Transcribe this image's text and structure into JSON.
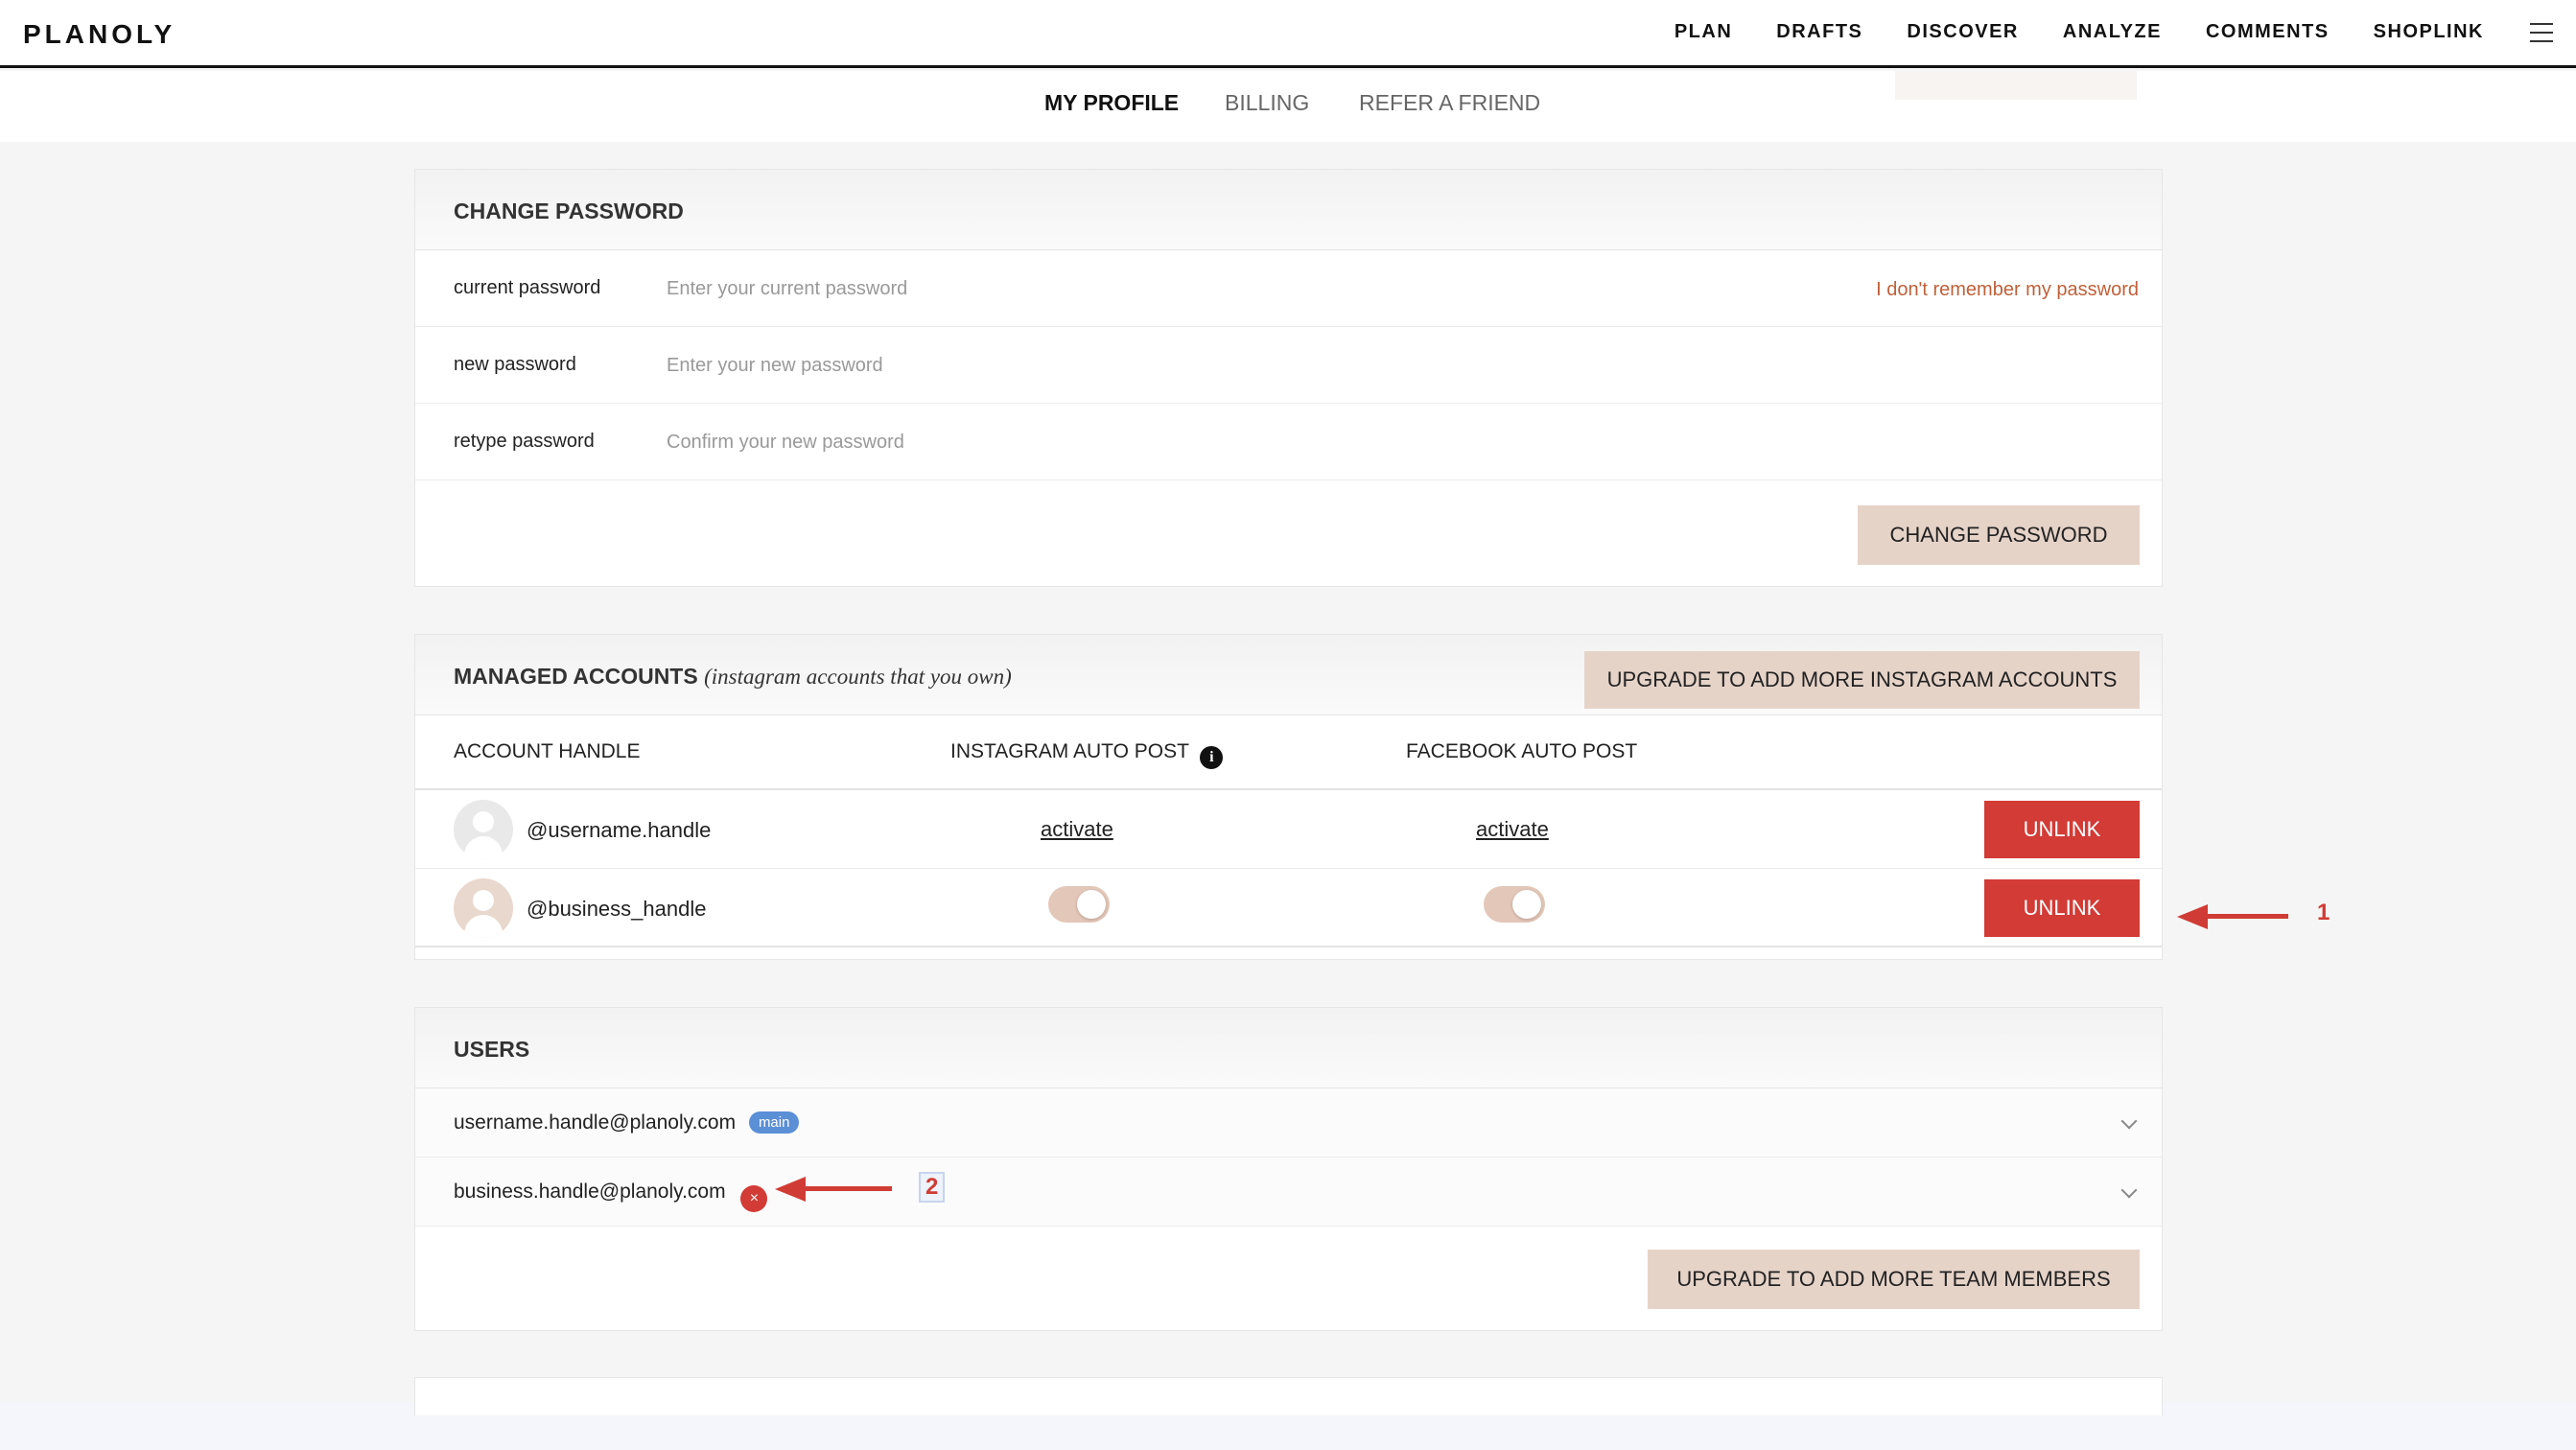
{
  "app": {
    "logo": "PLANOLY"
  },
  "nav": {
    "items": [
      "PLAN",
      "DRAFTS",
      "DISCOVER",
      "ANALYZE",
      "COMMENTS",
      "SHOPLINK"
    ]
  },
  "subtabs": {
    "items": [
      "MY PROFILE",
      "BILLING",
      "REFER A FRIEND"
    ],
    "active": "MY PROFILE"
  },
  "change_password": {
    "title": "CHANGE PASSWORD",
    "fields": [
      {
        "label": "current password",
        "placeholder": "Enter your current password"
      },
      {
        "label": "new password",
        "placeholder": "Enter your new password"
      },
      {
        "label": "retype password",
        "placeholder": "Confirm your new password"
      }
    ],
    "forgot_link": "I don't remember my password",
    "submit_label": "CHANGE PASSWORD"
  },
  "managed_accounts": {
    "title": "MANAGED ACCOUNTS",
    "subtitle": "(instagram accounts that you own)",
    "upgrade_label": "UPGRADE TO ADD MORE INSTAGRAM ACCOUNTS",
    "columns": [
      "ACCOUNT HANDLE",
      "INSTAGRAM AUTO POST",
      "FACEBOOK AUTO POST"
    ],
    "info_icon": "i",
    "rows": [
      {
        "handle": "@username.handle",
        "instagram": "activate",
        "facebook": "activate",
        "action": "UNLINK"
      },
      {
        "handle": "@business_handle",
        "instagram": "on",
        "facebook": "on",
        "action": "UNLINK"
      }
    ]
  },
  "users": {
    "title": "USERS",
    "rows": [
      {
        "email": "username.handle@planoly.com",
        "badge": "main"
      },
      {
        "email": "business.handle@planoly.com",
        "remove_icon": "×"
      }
    ],
    "upgrade_label": "UPGRADE TO ADD MORE TEAM MEMBERS"
  },
  "annotations": {
    "step1": "1",
    "step2": "2"
  },
  "colors": {
    "accent_beige": "#e6d3c8",
    "danger_red": "#d23b36",
    "link_orange": "#c0603a",
    "badge_blue": "#5b8fd6"
  }
}
